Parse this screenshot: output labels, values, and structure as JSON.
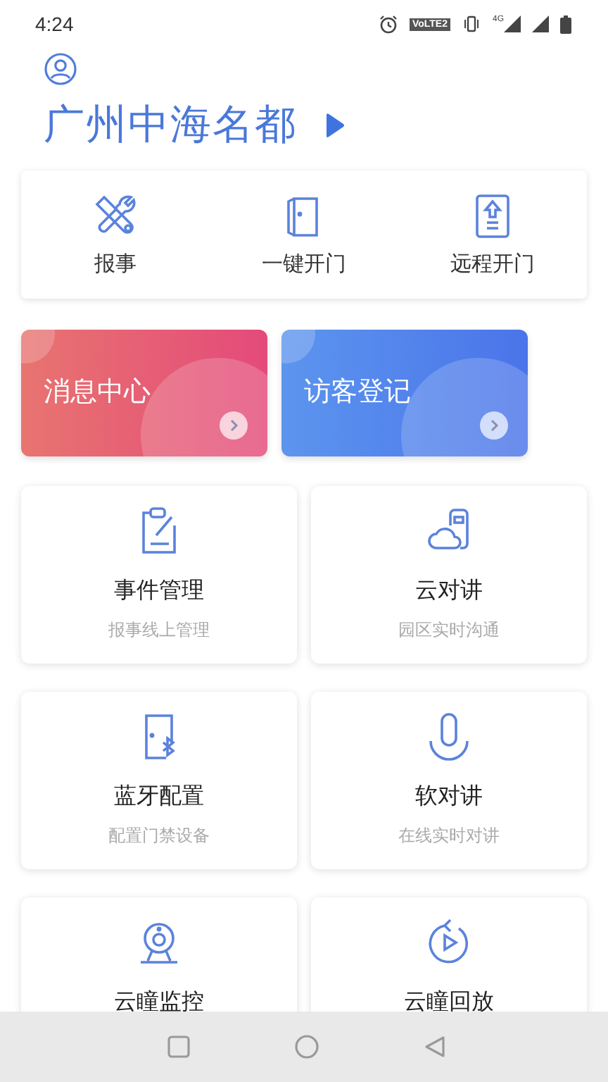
{
  "status_bar": {
    "time": "4:24",
    "volte": "VoLTE2",
    "network": "4G"
  },
  "community": {
    "name": "广州中海名都"
  },
  "quick_actions": [
    {
      "kind": "tools",
      "label": "报事"
    },
    {
      "kind": "door",
      "label": "一键开门"
    },
    {
      "kind": "remote",
      "label": "远程开门"
    }
  ],
  "banners": [
    {
      "title": "消息中心"
    },
    {
      "title": "访客登记"
    }
  ],
  "services": [
    {
      "kind": "clipboard",
      "title": "事件管理",
      "subtitle": "报事线上管理"
    },
    {
      "kind": "cloud-phone",
      "title": "云对讲",
      "subtitle": "园区实时沟通"
    },
    {
      "kind": "bluetooth-door",
      "title": "蓝牙配置",
      "subtitle": "配置门禁设备"
    },
    {
      "kind": "microphone",
      "title": "软对讲",
      "subtitle": "在线实时对讲"
    },
    {
      "kind": "webcam",
      "title": "云瞳监控"
    },
    {
      "kind": "replay",
      "title": "云瞳回放"
    }
  ]
}
